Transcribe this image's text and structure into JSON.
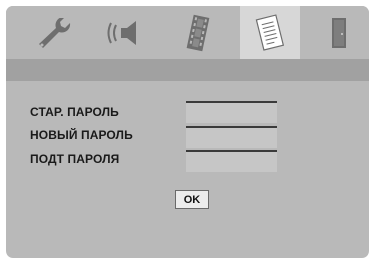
{
  "menu": {
    "tabs": [
      {
        "icon": "wrench-icon",
        "active": false
      },
      {
        "icon": "speaker-icon",
        "active": false
      },
      {
        "icon": "film-icon",
        "active": false
      },
      {
        "icon": "document-icon",
        "active": true
      },
      {
        "icon": "door-exit-icon",
        "active": false
      }
    ]
  },
  "form": {
    "old_password_label": "СТАР. ПАРОЛЬ",
    "new_password_label": "НОВЫЙ ПАРОЛЬ",
    "confirm_password_label": "ПОДТ ПАРОЛЯ",
    "old_password_value": "",
    "new_password_value": "",
    "confirm_password_value": ""
  },
  "buttons": {
    "ok_label": "OK"
  },
  "colors": {
    "panel": "#b9b9b9",
    "title_bar": "#a1a1a1",
    "active_tab": "#d7d7d7",
    "icon": "#6e6e6e"
  }
}
